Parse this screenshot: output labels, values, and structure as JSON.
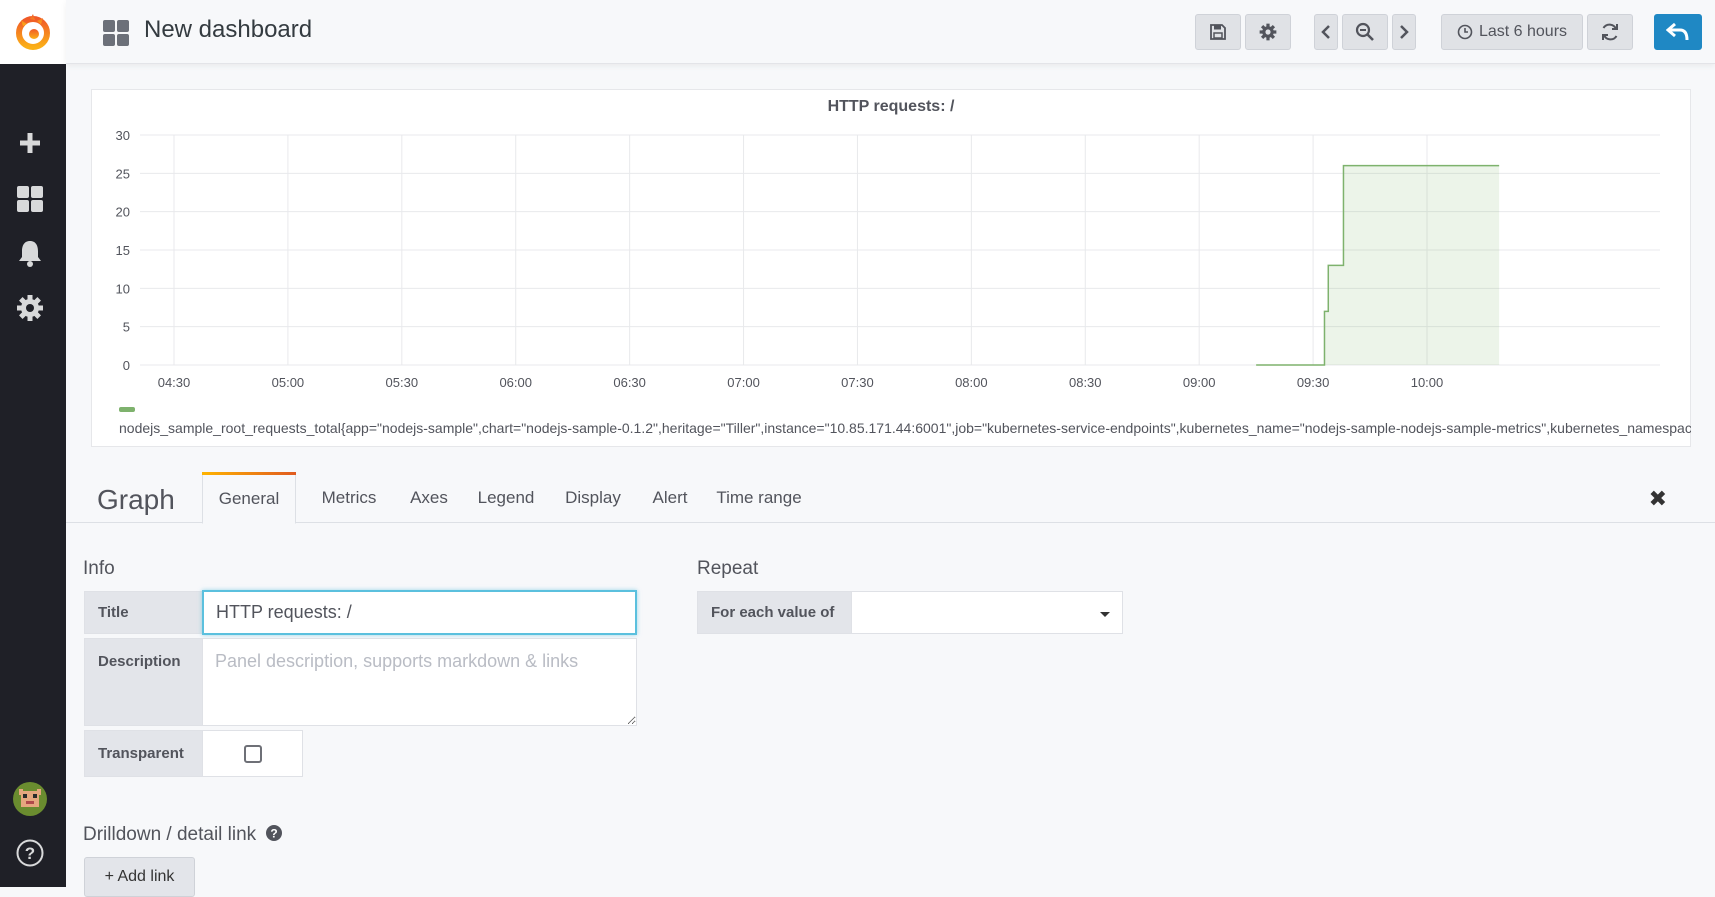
{
  "topnav": {
    "title": "New dashboard",
    "time_range": "Last 6 hours"
  },
  "panel": {
    "title": "HTTP requests: /",
    "legend_text": "nodejs_sample_root_requests_total{app=\"nodejs-sample\",chart=\"nodejs-sample-0.1.2\",heritage=\"Tiller\",instance=\"10.85.171.44:6001\",job=\"kubernetes-service-endpoints\",kubernetes_name=\"nodejs-sample-nodejs-sample-metrics\",kubernetes_namespace=\"c"
  },
  "chart_data": {
    "type": "line",
    "title": "HTTP requests: /",
    "y_ticks": [
      "0",
      "5",
      "10",
      "15",
      "20",
      "25",
      "30"
    ],
    "x_ticks": [
      "04:30",
      "05:00",
      "05:30",
      "06:00",
      "06:30",
      "07:00",
      "07:30",
      "08:00",
      "08:30",
      "09:00",
      "09:30",
      "10:00"
    ],
    "ylim": [
      0,
      30
    ],
    "x_unit": "minutes since 04:30 axis start",
    "series": [
      {
        "name": "nodejs_sample_root_requests_total",
        "color": "#7eb26d",
        "fill": true,
        "points": [
          [
            "09:15",
            0
          ],
          [
            "09:33",
            0
          ],
          [
            "09:33",
            7
          ],
          [
            "09:34",
            7
          ],
          [
            "09:34",
            13
          ],
          [
            "09:38",
            13
          ],
          [
            "09:38",
            26
          ],
          [
            "10:19",
            26
          ]
        ]
      }
    ],
    "grid": true
  },
  "editor": {
    "heading": "Graph",
    "tabs": [
      "General",
      "Metrics",
      "Axes",
      "Legend",
      "Display",
      "Alert",
      "Time range"
    ],
    "active_tab": "General",
    "info_heading": "Info",
    "title_label": "Title",
    "title_value": "HTTP requests: /",
    "description_label": "Description",
    "description_placeholder": "Panel description, supports markdown & links",
    "transparent_label": "Transparent",
    "repeat_heading": "Repeat",
    "repeat_label": "For each value of",
    "drilldown_heading": "Drilldown / detail link",
    "add_link_label": "+ Add link"
  },
  "colors": {
    "sidebar": "#1f2027",
    "primary": "#1f88c4",
    "series": "#7eb26d"
  }
}
